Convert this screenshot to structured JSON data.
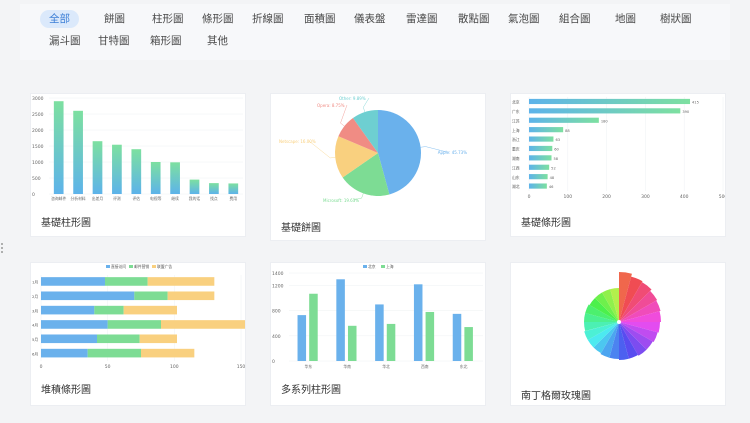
{
  "filters": {
    "tags": [
      "全部",
      "餅圖",
      "柱形圖",
      "條形圖",
      "折線圖",
      "面積圖",
      "儀表盤",
      "雷達圖",
      "散點圖",
      "氣泡圖",
      "組合圖",
      "地圖",
      "樹狀圖",
      "漏斗圖",
      "甘特圖",
      "箱形圖",
      "其他"
    ],
    "active_index": 0
  },
  "cards": [
    {
      "caption": "基礎柱形圖",
      "chart_data": {
        "type": "bar",
        "categories": [
          "咨询邮件",
          "分析材料",
          "出差月",
          "评测",
          "评估",
          "电视等",
          "继续",
          "我的话",
          "找点",
          "费用"
        ],
        "values": [
          2900,
          2600,
          1650,
          1540,
          1400,
          1000,
          990,
          450,
          340,
          330
        ],
        "ylim": [
          0,
          3000
        ],
        "yticks": [
          "0",
          "500",
          "1000",
          "1500",
          "2000",
          "2500",
          "3000"
        ]
      }
    },
    {
      "caption": "基礎餅圖",
      "chart_data": {
        "type": "pie",
        "slices": [
          {
            "label": "Apple: 45.73%",
            "value": 45.73,
            "color": "#6ab1ec"
          },
          {
            "label": "Microsoft: 19.63%",
            "value": 19.63,
            "color": "#7ddc94"
          },
          {
            "label": "Netscape: 16.00%",
            "value": 16.0,
            "color": "#f9d07f"
          },
          {
            "label": "Opera: 8.75%",
            "value": 8.75,
            "color": "#f08c84"
          },
          {
            "label": "Other: 9.89%",
            "value": 9.89,
            "color": "#6ecfd1"
          }
        ]
      }
    },
    {
      "caption": "基礎條形圖",
      "chart_data": {
        "type": "bar",
        "categories": [
          "北京",
          "广东",
          "江苏",
          "上海",
          "浙江",
          "重庆",
          "湖南",
          "江西",
          "山东",
          "湖北"
        ],
        "values": [
          415,
          390,
          180,
          88,
          63,
          60,
          58,
          52,
          48,
          46
        ],
        "value_labels": [
          "415",
          "390",
          "180",
          "88",
          "63",
          "60",
          "58",
          "52",
          "48",
          "46"
        ],
        "xlim": [
          0,
          500
        ],
        "xticks": [
          "0",
          "100",
          "200",
          "300",
          "400",
          "500"
        ]
      }
    },
    {
      "caption": "堆積條形圖",
      "chart_data": {
        "type": "bar",
        "categories": [
          "1月",
          "2月",
          "3月",
          "4月",
          "5月",
          "6月"
        ],
        "series": [
          {
            "name": "直接访问",
            "values": [
              48,
              70,
              40,
              50,
              42,
              35
            ],
            "color": "#6ab1ec"
          },
          {
            "name": "邮件营销",
            "values": [
              32,
              25,
              22,
              40,
              32,
              40
            ],
            "color": "#7ddc94"
          },
          {
            "name": "联盟广告",
            "values": [
              50,
              35,
              40,
              73,
              28,
              40
            ],
            "color": "#f9d07f"
          }
        ],
        "xlim": [
          0,
          150
        ],
        "xticks": [
          "0",
          "50",
          "100",
          "150"
        ]
      }
    },
    {
      "caption": "多系列柱形圖",
      "chart_data": {
        "type": "bar",
        "categories": [
          "华东",
          "华南",
          "华北",
          "西南",
          "东北"
        ],
        "series": [
          {
            "name": "北京",
            "values": [
              730,
              1300,
              900,
              1220,
              750
            ],
            "color": "#6ab1ec"
          },
          {
            "name": "上海",
            "values": [
              1070,
              560,
              590,
              780,
              540
            ],
            "color": "#7ddc94"
          }
        ],
        "ylim": [
          0,
          1400
        ],
        "yticks": [
          "0",
          "400",
          "800",
          "1200",
          "1400"
        ]
      }
    },
    {
      "caption": "南丁格爾玫瑰圖",
      "chart_data": {
        "type": "pie",
        "rose": true,
        "values": [
          50,
          47,
          46,
          44,
          43,
          42,
          41,
          40,
          39,
          39,
          38,
          38,
          37,
          37,
          36,
          36,
          36,
          35,
          35,
          35,
          34,
          34,
          34,
          34
        ]
      }
    }
  ]
}
